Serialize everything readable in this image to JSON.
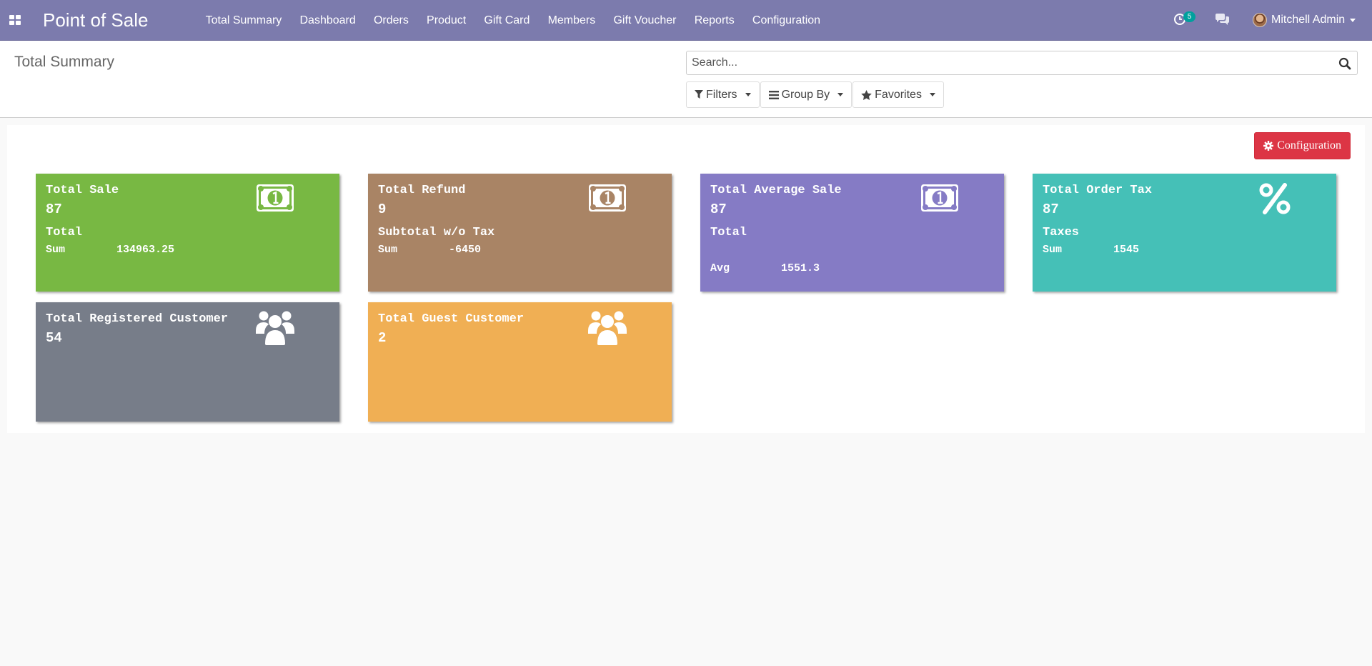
{
  "navbar": {
    "brand": "Point of Sale",
    "menu": [
      "Total Summary",
      "Dashboard",
      "Orders",
      "Product",
      "Gift Card",
      "Members",
      "Gift Voucher",
      "Reports",
      "Configuration"
    ],
    "activity_count": "5",
    "user_name": "Mitchell Admin"
  },
  "control_panel": {
    "title": "Total Summary",
    "search_placeholder": "Search...",
    "filters_label": "Filters",
    "group_by_label": "Group By",
    "favorites_label": "Favorites"
  },
  "content": {
    "config_button_label": "Configuration",
    "cards": [
      {
        "title": "Total Sale",
        "count": "87",
        "sub": "Total",
        "metric_label": "Sum",
        "metric_value": "134963.25",
        "color": "#78b843",
        "icon": "money-icon"
      },
      {
        "title": "Total Refund",
        "count": "9",
        "sub": "Subtotal w/o Tax",
        "metric_label": "Sum",
        "metric_value": "-6450",
        "color": "#a98465",
        "icon": "money-icon"
      },
      {
        "title": "Total Average Sale",
        "count": "87",
        "sub": "Total",
        "metric_label": "Avg",
        "metric_value": "1551.3",
        "color": "#857bc5",
        "icon": "money-icon"
      },
      {
        "title": "Total Order Tax",
        "count": "87",
        "sub": "Taxes",
        "metric_label": "Sum",
        "metric_value": "1545",
        "color": "#45c0b7",
        "icon": "percent-icon"
      },
      {
        "title": "Total Registered Customer",
        "count": "54",
        "color": "#777d89",
        "icon": "users-icon"
      },
      {
        "title": "Total Guest Customer",
        "count": "2",
        "color": "#f0af54",
        "icon": "users-icon"
      }
    ]
  }
}
